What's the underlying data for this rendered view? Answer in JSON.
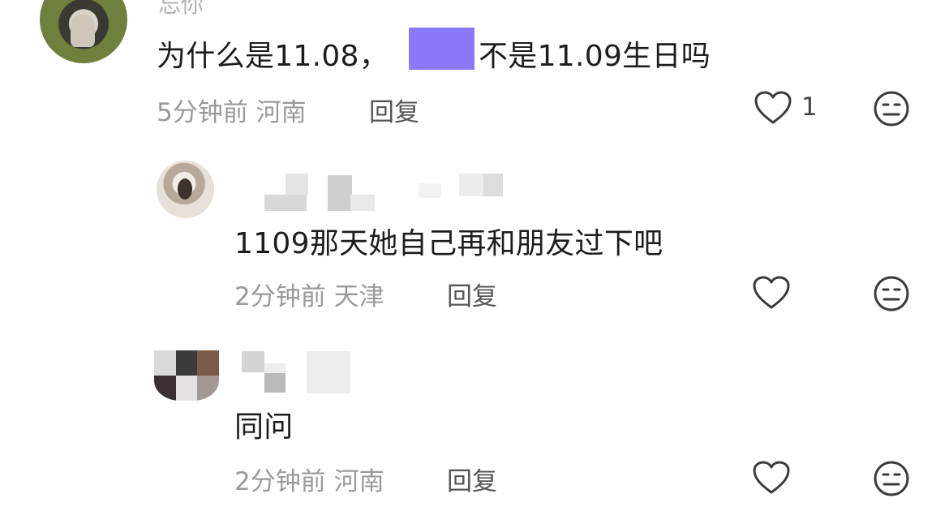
{
  "comments": [
    {
      "name_fragment": "忘你",
      "text_before": "为什么是11.08，",
      "text_after": "不是11.09生日吗",
      "time": "5分钟前",
      "location": "河南",
      "reply_label": "回复",
      "like_count": "1"
    },
    {
      "text": "1109那天她自己再和朋友过下吧",
      "time": "2分钟前",
      "location": "天津",
      "reply_label": "回复"
    },
    {
      "text": "同问",
      "time": "2分钟前",
      "location": "河南",
      "reply_label": "回复"
    }
  ],
  "colors": {
    "mention_redaction": "#8a7af8",
    "meta_text": "#9a9a9a",
    "icon_stroke": "#3a3a3a"
  },
  "icons": [
    "heart-icon",
    "dislike-face-icon"
  ]
}
